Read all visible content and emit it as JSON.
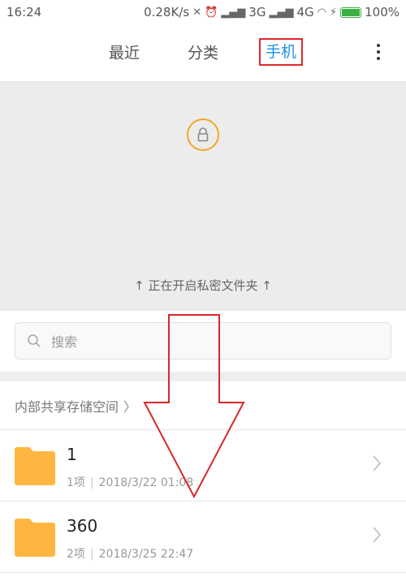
{
  "status_bar": {
    "time": "16:24",
    "speed": "0.28K/s",
    "network1": "3G",
    "network2": "4G",
    "battery": "100%"
  },
  "nav": {
    "tabs": [
      "最近",
      "分类",
      "手机"
    ],
    "active_tab": "手机"
  },
  "private_folder": {
    "hint": "↑ 正在开启私密文件夹 ↑"
  },
  "search": {
    "placeholder": "搜索"
  },
  "storage": {
    "title": "内部共享存储空间",
    "folders": [
      {
        "name": "1",
        "items": "1项",
        "date": "2018/3/22 01:08"
      },
      {
        "name": "360",
        "items": "2项",
        "date": "2018/3/25 22:47"
      }
    ]
  },
  "colors": {
    "accent": "#1e90e6",
    "highlight": "#e0282a",
    "folder": "#ffb640",
    "lock": "#f5a623"
  }
}
